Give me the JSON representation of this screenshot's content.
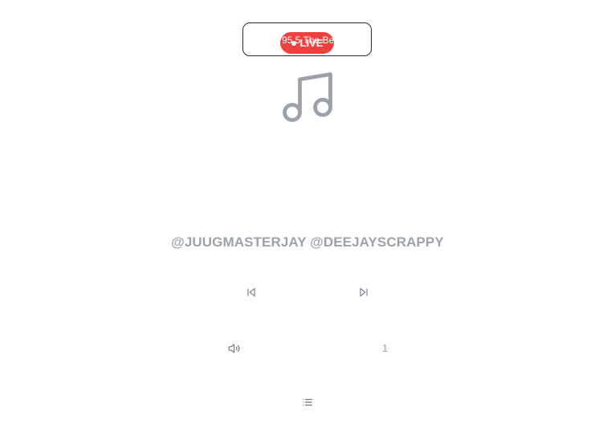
{
  "station": {
    "name": "95.5 The Beat",
    "live_label": "LIVE"
  },
  "now_playing": {
    "artist": "@JUUGMASTERJAY @DEEJAYSCRAPPY"
  },
  "controls": {
    "previous_icon": "skip-back-icon",
    "next_icon": "skip-forward-icon",
    "volume_icon": "volume-icon",
    "listener_count": "1",
    "playlist_icon": "list-icon"
  },
  "colors": {
    "live_badge": "#ef4040",
    "muted_text": "#9ca1ac",
    "box_border": "#2b2b2b"
  }
}
